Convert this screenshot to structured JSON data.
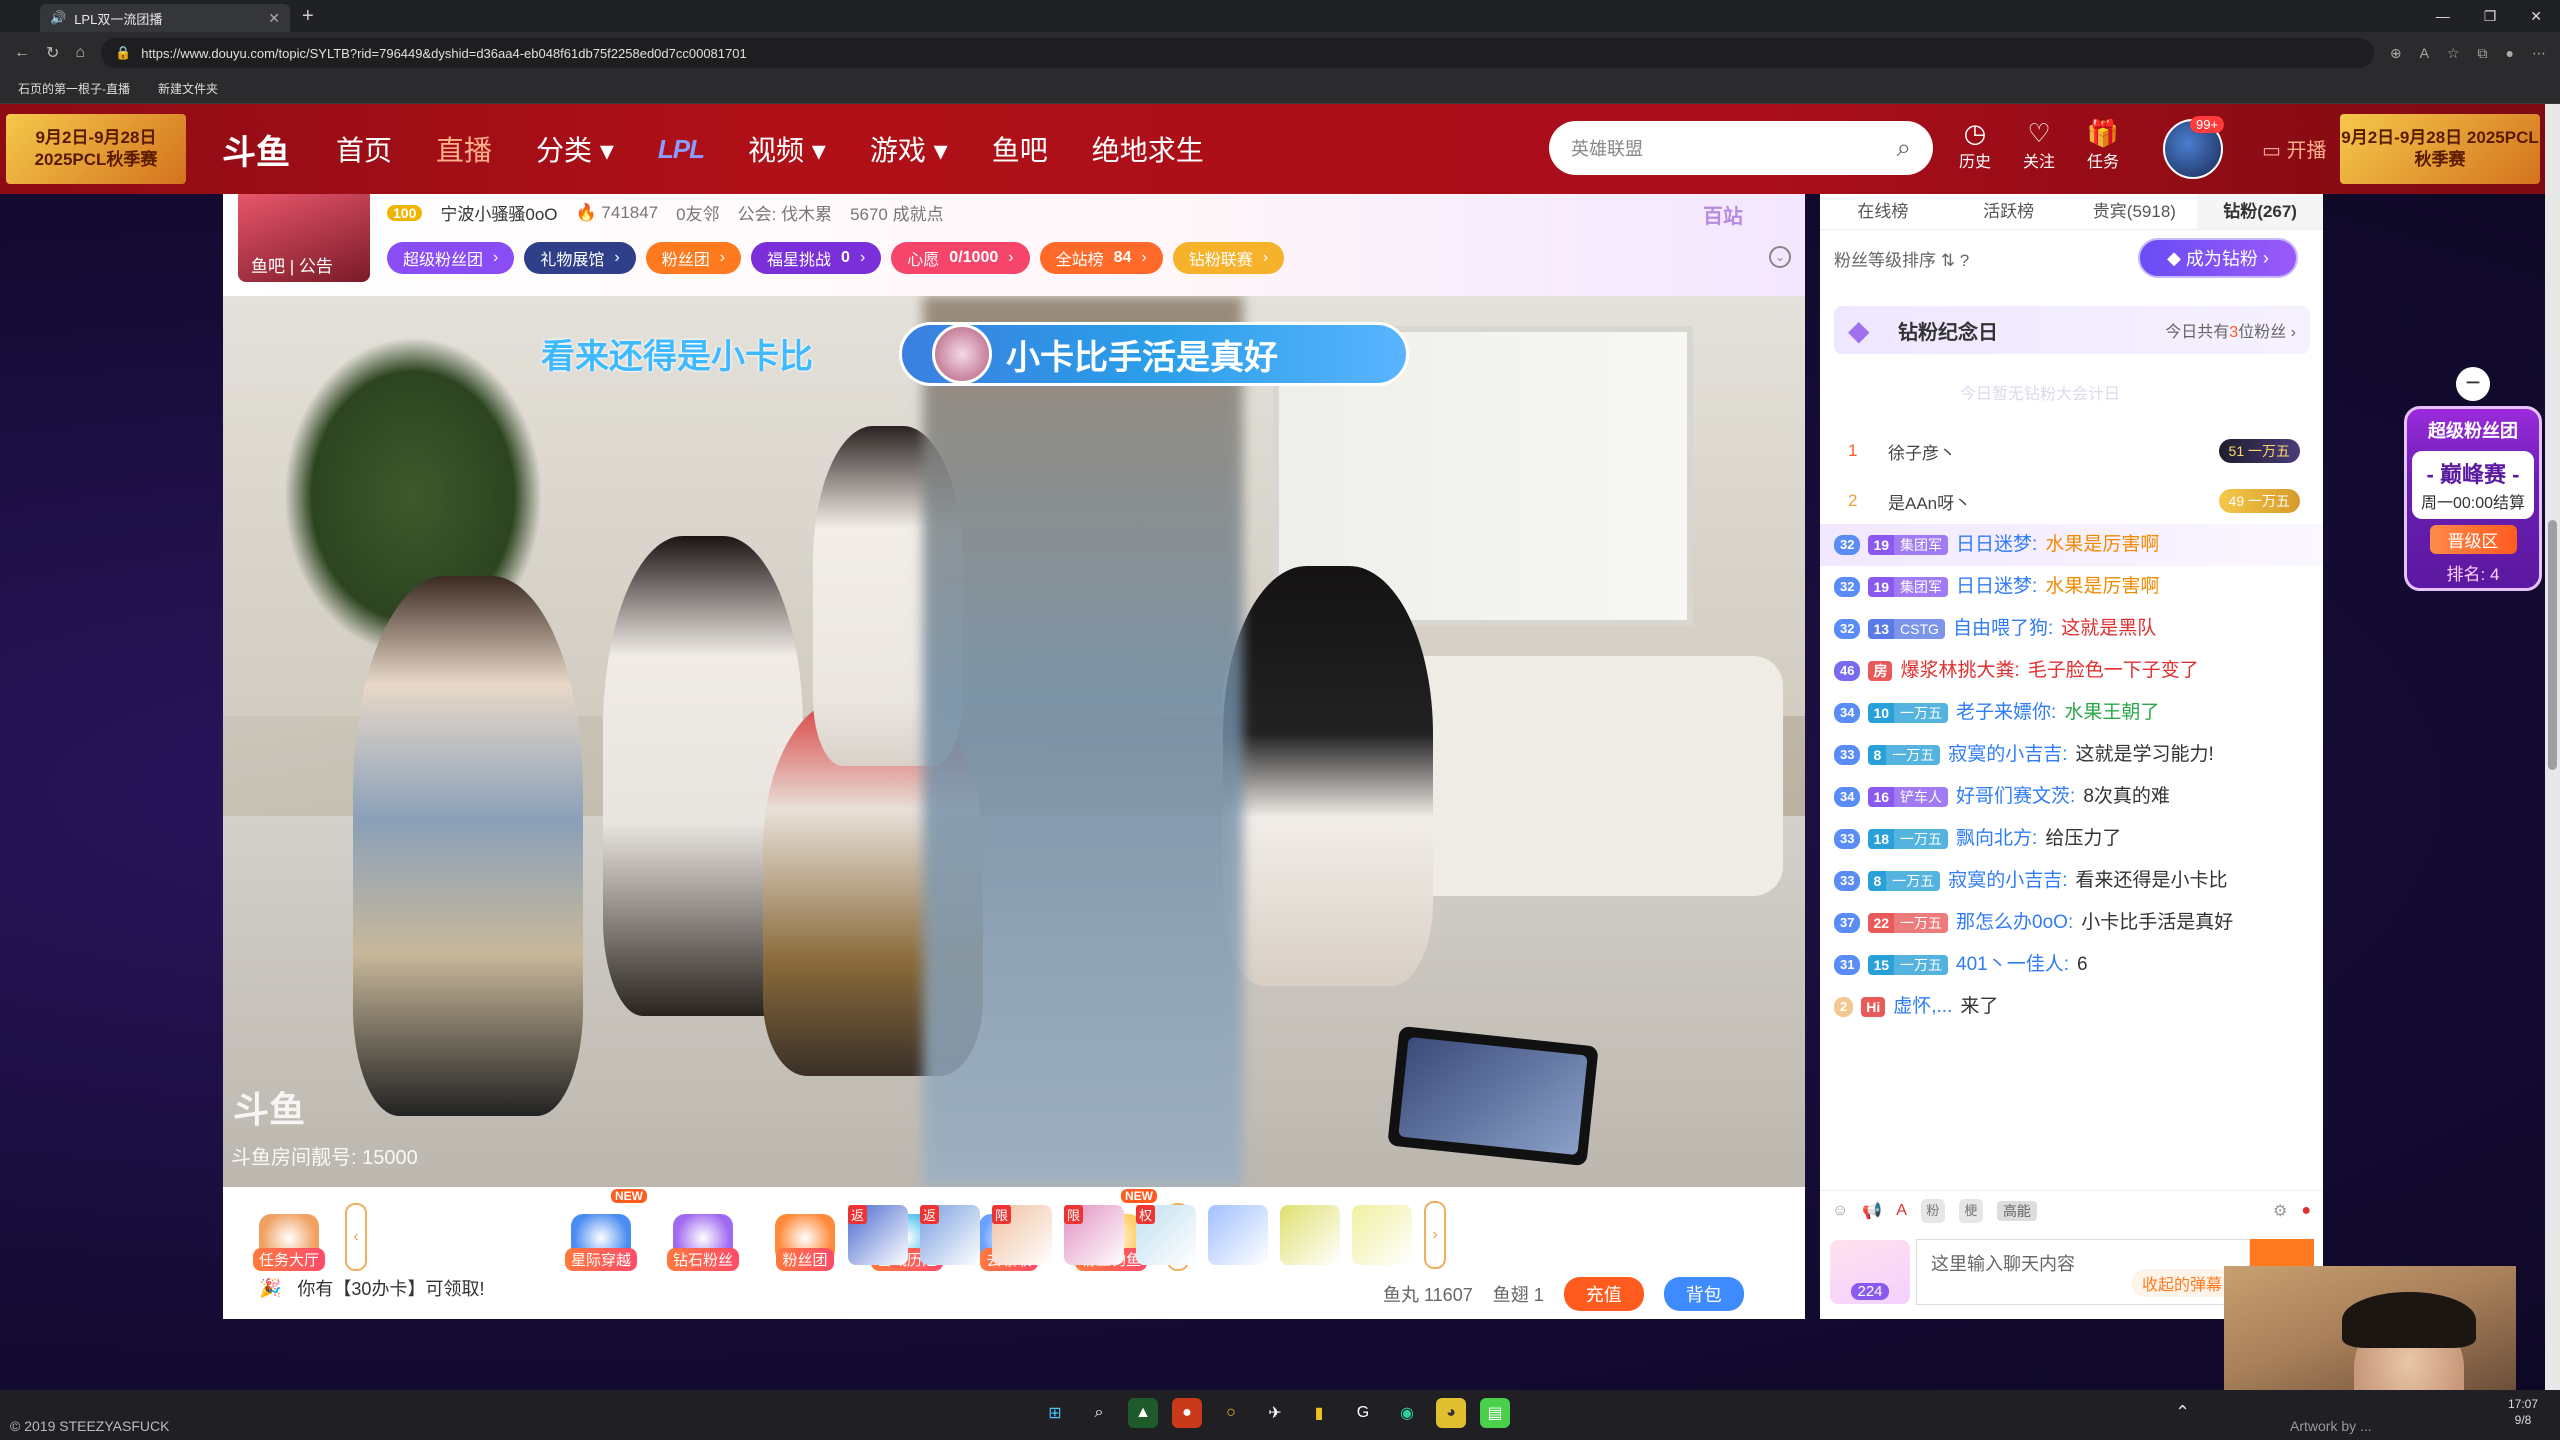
{
  "browser": {
    "tab_title": "LPL双一流团播",
    "url": "https://www.douyu.com/topic/SYLTB?rid=796449&dyshid=d36aa4-eb048f61db75f2258ed0d7cc00081701",
    "bookmarks": [
      "石页的第一根子-直播",
      "新建文件夹"
    ]
  },
  "header": {
    "banner_left": "9月2日-9月28日 2025PCL秋季赛",
    "logo": "斗鱼",
    "nav": [
      "首页",
      "直播",
      "分类",
      "视频",
      "游戏",
      "鱼吧",
      "绝地求生"
    ],
    "nav_active": "直播",
    "nav_logo": "LPL",
    "search_placeholder": "英雄联盟",
    "icons": [
      {
        "label": "历史",
        "icon": "clock-icon"
      },
      {
        "label": "关注",
        "icon": "heart-icon"
      },
      {
        "label": "任务",
        "icon": "gift-icon"
      }
    ],
    "avatar_badge": "99+",
    "open_live": "开播",
    "banner_right": "9月2日-9月28日 2025PCL秋季赛"
  },
  "room": {
    "avatar_links": "鱼吧 | 公告",
    "level": "100",
    "anchor": "宁波小骚骚0oO",
    "hot": "741847",
    "friends": "0友邻",
    "guild": "公会: 伐木累",
    "achievement": "5670 成就点",
    "rank_tag": "百站",
    "pills": [
      {
        "label": "超级粉丝团",
        "color": "#8a4cf5"
      },
      {
        "label": "礼物展馆",
        "color": "#2f3f8a"
      },
      {
        "label": "粉丝团",
        "color": "#ff7a1f"
      },
      {
        "label": "福星挑战",
        "extra": "0",
        "color": "#7a2fd8"
      },
      {
        "label": "心愿",
        "extra": "0/1000",
        "color": "#f5456a"
      },
      {
        "label": "全站榜",
        "extra": "84",
        "color": "#ff6a2a"
      },
      {
        "label": "钻粉联赛",
        "color": "#f5b22a"
      }
    ]
  },
  "video": {
    "danmu_text": "看来还得是小卡比",
    "banner_text": "小卡比手活是真好",
    "watermark": "斗鱼",
    "room_number": "斗鱼房间靓号: 15000"
  },
  "bottom": {
    "gifts": [
      {
        "label": "任务大厅",
        "new": false,
        "color": "#f0a060"
      },
      {
        "label": "星际穿越",
        "new": true,
        "color": "#4a8cf0"
      },
      {
        "label": "钻石粉丝",
        "new": false,
        "color": "#a06af0"
      },
      {
        "label": "粉丝团",
        "new": false,
        "color": "#ff8a3a"
      },
      {
        "label": "雪域历险",
        "new": false,
        "color": "#4ac0f0"
      },
      {
        "label": "去领取",
        "new": false,
        "color": "#6aa0ff"
      },
      {
        "label": "粉丝钓鱼",
        "new": true,
        "color": "#ffd06a"
      }
    ],
    "small_gift_tags": [
      "返",
      "返",
      "限",
      "限",
      "权",
      "",
      "",
      ""
    ],
    "claim_text": "你有【30办卡】可领取!",
    "fish_ball": "鱼丸 11607",
    "fish_fin": "鱼翅 1",
    "recharge": "充值",
    "bag": "背包"
  },
  "panel": {
    "tabs": [
      "在线榜",
      "活跃榜",
      "贵宾(5918)",
      "钻粉(267)"
    ],
    "active_tab": "钻粉(267)",
    "rank_header": "粉丝等级排序 ⇅",
    "become_diamond": "成为钻粉",
    "memorial_title": "钻粉纪念日",
    "memorial_prefix": "今日共有",
    "memorial_count": "3",
    "memorial_suffix": "位粉丝",
    "memorial_empty": "今日暂无钻粉大会计日",
    "ranks": [
      {
        "num": "1",
        "name": "徐子彦丶",
        "badge": "51 一万五"
      },
      {
        "num": "2",
        "name": "是AAn呀丶",
        "badge": "49 一万五"
      }
    ],
    "chat": [
      {
        "lv": "32",
        "lvc": "#5a8cf5",
        "fl": "19",
        "fn": "集团军",
        "fc": "#8a5af0",
        "name": "日日迷梦:",
        "msg": "水果是厉害啊",
        "mc": "y",
        "hl": true
      },
      {
        "lv": "32",
        "lvc": "#5a8cf5",
        "fl": "19",
        "fn": "集团军",
        "fc": "#8a5af0",
        "name": "日日迷梦:",
        "msg": "水果是厉害啊",
        "mc": "y",
        "hl": false
      },
      {
        "lv": "32",
        "lvc": "#5a8cf5",
        "fl": "13",
        "fn": "CSTG",
        "fc": "#5a7ae8",
        "name": "自由喂了狗:",
        "msg": "这就是黑队",
        "mc": "r",
        "hl": false
      },
      {
        "lv": "46",
        "lvc": "#7a6af0",
        "fl": "房",
        "fn": "",
        "fc": "#e85a5a",
        "name": "爆浆林挑大粪:",
        "msg": "毛子脸色一下子变了",
        "mc": "r",
        "hl": false,
        "nr": true
      },
      {
        "lv": "34",
        "lvc": "#5a8cf5",
        "fl": "10",
        "fn": "一万五",
        "fc": "#2aa0d8",
        "name": "老子来嫖你:",
        "msg": "水果王朝了",
        "mc": "g",
        "hl": false
      },
      {
        "lv": "33",
        "lvc": "#5a8cf5",
        "fl": "8",
        "fn": "一万五",
        "fc": "#2aa0d8",
        "name": "寂寞的小吉吉:",
        "msg": "这就是学习能力!",
        "mc": "",
        "hl": false
      },
      {
        "lv": "34",
        "lvc": "#5a8cf5",
        "fl": "16",
        "fn": "铲车人",
        "fc": "#8a5af0",
        "name": "好哥们赛文茨:",
        "msg": "8次真的难",
        "mc": "",
        "hl": false
      },
      {
        "lv": "33",
        "lvc": "#5a8cf5",
        "fl": "18",
        "fn": "一万五",
        "fc": "#2aa0d8",
        "name": "飘向北方:",
        "msg": "给压力了",
        "mc": "",
        "hl": false
      },
      {
        "lv": "33",
        "lvc": "#5a8cf5",
        "fl": "8",
        "fn": "一万五",
        "fc": "#2aa0d8",
        "name": "寂寞的小吉吉:",
        "msg": "看来还得是小卡比",
        "mc": "",
        "hl": false
      },
      {
        "lv": "37",
        "lvc": "#5a8cf5",
        "fl": "22",
        "fn": "一万五",
        "fc": "#e85a5a",
        "name": "那怎么办0oO:",
        "msg": "小卡比手活是真好",
        "mc": "",
        "hl": false
      },
      {
        "lv": "31",
        "lvc": "#5a8cf5",
        "fl": "15",
        "fn": "一万五",
        "fc": "#2aa0d8",
        "name": "401丶一佳人:",
        "msg": "6",
        "mc": "",
        "hl": false
      },
      {
        "lv": "2",
        "lvc": "#f0c890",
        "fl": "Hi",
        "fn": "",
        "fc": "#e85a5a",
        "name": "虚怀,...",
        "msg": "来了",
        "mc": "",
        "hl": false
      }
    ],
    "tools": [
      "粉",
      "梗",
      "高能"
    ],
    "badge_count": "224",
    "input_placeholder": "这里输入聊天内容",
    "collapse": "收起的弹幕"
  },
  "float_widget": {
    "title": "超级粉丝团",
    "main": "- 巅峰赛 -",
    "sub": "周一00:00结算",
    "button": "晋级区",
    "rank": "排名: 4"
  },
  "taskbar": {
    "copyright": "© 2019 STEEZYASFUCK",
    "artwork": "Artwork by ...",
    "time": "17:07",
    "date": "9/8"
  }
}
